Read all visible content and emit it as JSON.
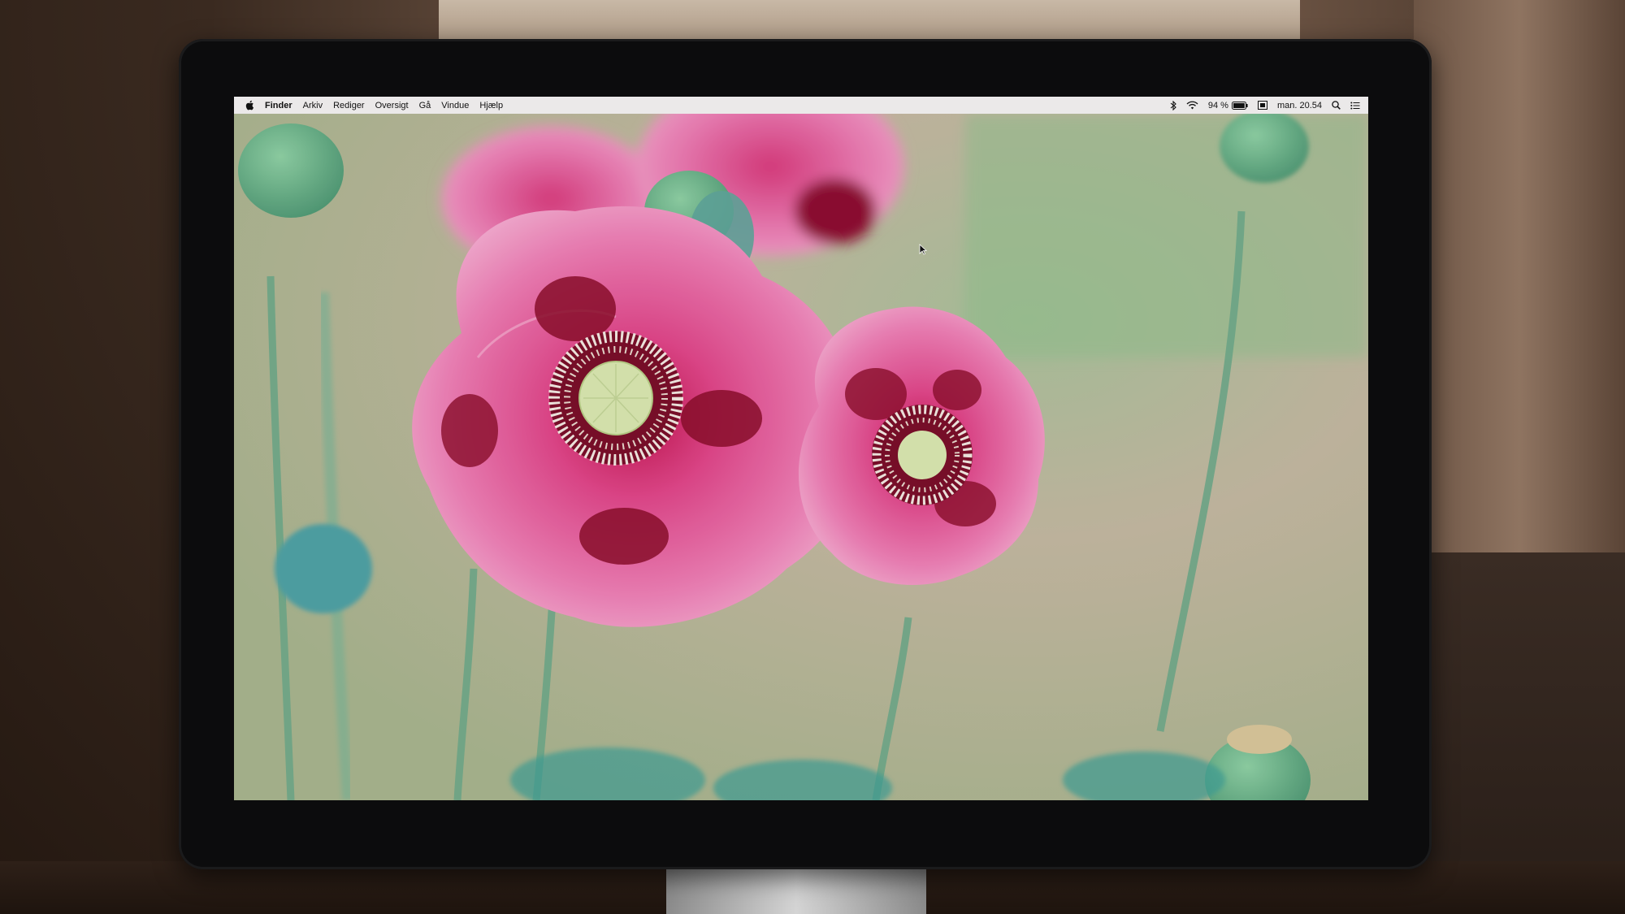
{
  "menubar": {
    "apple_icon": "apple-icon",
    "app_name": "Finder",
    "items": [
      {
        "label": "Arkiv"
      },
      {
        "label": "Rediger"
      },
      {
        "label": "Oversigt"
      },
      {
        "label": "Gå"
      },
      {
        "label": "Vindue"
      },
      {
        "label": "Hjælp"
      }
    ],
    "status": {
      "bluetooth_icon": "bluetooth-icon",
      "wifi_icon": "wifi-icon",
      "battery_percent": "94 %",
      "battery_icon": "battery-icon",
      "display_icon": "display-icon",
      "clock": "man. 20.54",
      "search_icon": "spotlight-search-icon",
      "notification_icon": "notification-center-icon"
    }
  },
  "colors": {
    "menubar_bg": "#eeecee",
    "petal_pink": "#e8649e",
    "petal_light": "#f29ac4",
    "center_dark": "#7a0f2a",
    "stem_green": "#6fa88a",
    "background_bokeh": "#b7b59a"
  }
}
